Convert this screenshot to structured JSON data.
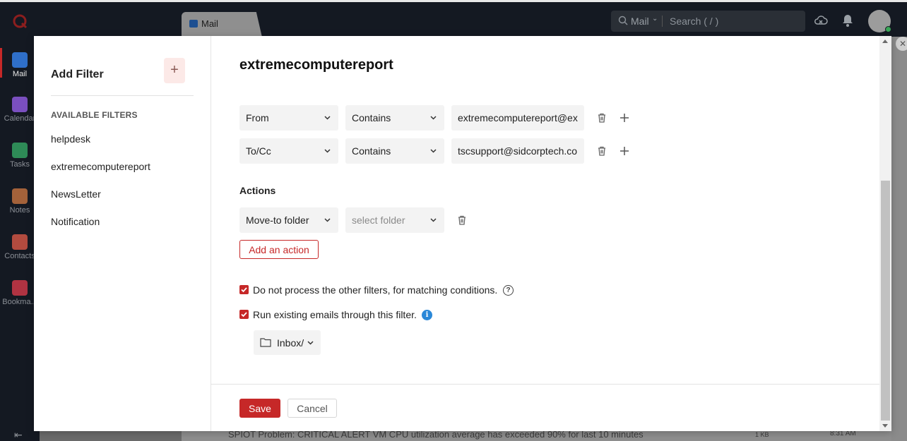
{
  "app": {
    "tab_label": "Mail",
    "search_scope": "Mail",
    "search_placeholder": "Search ( / )",
    "sidebar": [
      {
        "label": "Mail",
        "icon": "mail-icon",
        "color": "#2f6fc9"
      },
      {
        "label": "Calendar",
        "icon": "calendar-icon",
        "color": "#7a4fbf"
      },
      {
        "label": "Tasks",
        "icon": "tasks-icon",
        "color": "#2e8b57"
      },
      {
        "label": "Notes",
        "icon": "notes-icon",
        "color": "#a4623a"
      },
      {
        "label": "Contacts",
        "icon": "contacts-icon",
        "color": "#b24b3f"
      },
      {
        "label": "Bookma...",
        "icon": "bookmark-icon",
        "color": "#b03342"
      }
    ],
    "background_row": {
      "subject": "SPIOT Problem: CRITICAL ALERT VM CPU utilization average has exceeded 90% for last 10 minutes",
      "size": "1 KB",
      "time": "8:31 AM"
    }
  },
  "modal": {
    "left": {
      "title": "Add Filter",
      "add_button": "+",
      "section_heading": "AVAILABLE FILTERS",
      "filters": [
        "helpdesk",
        "extremecomputereport",
        "NewsLetter",
        "Notification"
      ]
    },
    "rule": {
      "name": "extremecomputereport",
      "conditions": [
        {
          "field": "From",
          "operator": "Contains",
          "value": "extremecomputereport@ex"
        },
        {
          "field": "To/Cc",
          "operator": "Contains",
          "value": "tscsupport@sidcorptech.co"
        }
      ],
      "actions_heading": "Actions",
      "action": {
        "type": "Move-to folder",
        "folder_placeholder": "select folder"
      },
      "add_action_label": "Add an action",
      "options": [
        {
          "label": "Do not process the other filters, for matching conditions.",
          "checked": true,
          "hint_icon": "help-icon"
        },
        {
          "label": "Run existing emails through this filter.",
          "checked": true,
          "hint_icon": "info-icon"
        }
      ],
      "run_folder": "Inbox/"
    },
    "footer": {
      "save": "Save",
      "cancel": "Cancel"
    }
  },
  "colors": {
    "accent": "#c62828",
    "info": "#2b88d8",
    "input_bg": "#f3f3f3"
  }
}
